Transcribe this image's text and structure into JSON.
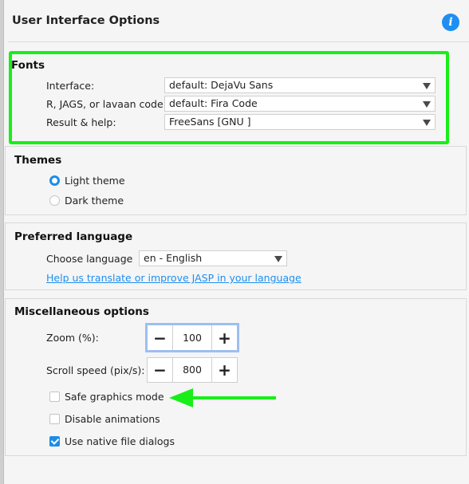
{
  "page": {
    "title": "User Interface Options"
  },
  "icons": {
    "info": "info-icon"
  },
  "fonts": {
    "title": "Fonts",
    "rows": [
      {
        "label": "Interface:",
        "value": "default: DejaVu Sans"
      },
      {
        "label": "R, JAGS, or lavaan code:",
        "value": "default: Fira Code"
      },
      {
        "label": "Result & help:",
        "value": "FreeSans [GNU ]"
      }
    ]
  },
  "themes": {
    "title": "Themes",
    "options": [
      {
        "label": "Light theme",
        "selected": true
      },
      {
        "label": "Dark theme",
        "selected": false
      }
    ]
  },
  "language": {
    "title": "Preferred language",
    "choose_label": "Choose language",
    "value": "en - English",
    "link": "Help us translate or improve JASP in your language"
  },
  "misc": {
    "title": "Miscellaneous options",
    "zoom_label": "Zoom (%):",
    "zoom_value": "100",
    "scroll_label": "Scroll speed (pix/s):",
    "scroll_value": "800",
    "minus": "−",
    "plus": "+",
    "checkboxes": [
      {
        "label": "Safe graphics mode",
        "checked": false
      },
      {
        "label": "Disable animations",
        "checked": false
      },
      {
        "label": "Use native file dialogs",
        "checked": true
      }
    ]
  },
  "annotation_color": "#19ee19",
  "accent_color": "#1e8ff0"
}
